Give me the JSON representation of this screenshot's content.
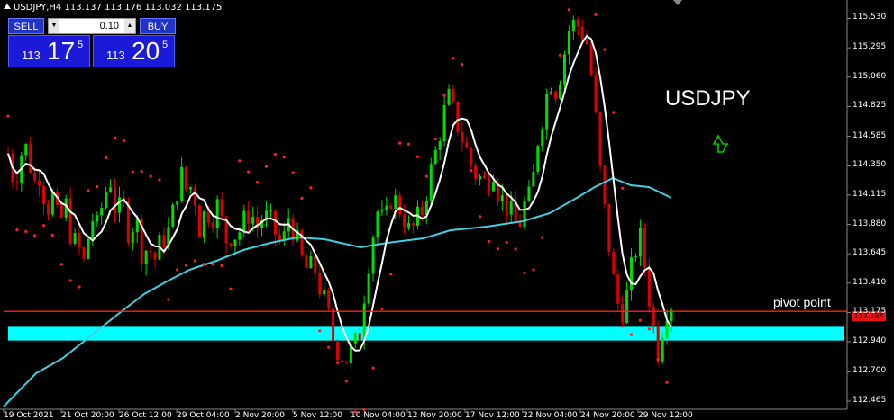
{
  "header": {
    "symbol_info": "USDJPY,H4  113.137 113.176 113.032 113.175"
  },
  "trade_panel": {
    "sell_label": "SELL",
    "buy_label": "BUY",
    "lot_value": "0.10",
    "sell_price": {
      "prefix": "113",
      "big": "17",
      "sup": "5"
    },
    "buy_price": {
      "prefix": "113",
      "big": "20",
      "sup": "5"
    }
  },
  "annotations": {
    "symbol_title": "USDJPY",
    "pivot_label": "pivot point",
    "arrow_icon": "up-arrow-icon",
    "current_price_tag": "113.184"
  },
  "colors": {
    "bull": "#00dd00",
    "bear": "#dd0000",
    "moving_avg_slow": "#40d0e0",
    "moving_avg_fast": "#ffffff",
    "parabolic_sar": "#ff2020",
    "pivot_line": "#ff2020",
    "zone": "#00ffff",
    "arrow": "#00cc00"
  },
  "chart_data": {
    "type": "candlestick",
    "symbol": "USDJPY",
    "timeframe": "H4",
    "ylim": [
      112.465,
      115.62
    ],
    "y_ticks": [
      "115.530",
      "115.295",
      "115.060",
      "114.825",
      "114.585",
      "114.350",
      "114.115",
      "113.880",
      "113.645",
      "113.410",
      "113.175",
      "112.940",
      "112.700",
      "112.465"
    ],
    "x_ticks": [
      "19 Oct 2021",
      "21 Oct 20:00",
      "26 Oct 12:00",
      "29 Oct 04:00",
      "2 Nov 20:00",
      "5 Nov 12:00",
      "10 Nov 04:00",
      "12 Nov 20:00",
      "17 Nov 12:00",
      "22 Nov 04:00",
      "24 Nov 20:00",
      "29 Nov 12:00"
    ],
    "pivot_point": 113.184,
    "zone": [
      112.95,
      113.06
    ],
    "close_path": [
      114.45,
      114.2,
      114.45,
      114.5,
      114.2,
      114.3,
      114.0,
      114.1,
      113.85,
      114.05,
      113.75,
      113.7,
      113.55,
      113.95,
      113.85,
      114.1,
      114.25,
      113.95,
      114.05,
      113.8,
      113.95,
      113.65,
      113.7,
      113.6,
      113.75,
      113.8,
      114.0,
      114.3,
      114.15,
      114.2,
      113.85,
      114.0,
      113.95,
      114.05,
      113.75,
      113.8,
      113.8,
      113.9,
      114.0,
      113.85,
      113.95,
      113.9,
      113.8,
      113.7,
      113.95,
      113.8,
      113.6,
      113.5,
      113.55,
      113.35,
      113.2,
      112.95,
      112.85,
      112.8,
      112.9,
      112.95,
      113.4,
      113.75,
      114.0,
      113.85,
      114.1,
      114.05,
      113.95,
      113.8,
      113.9,
      114.0,
      114.25,
      114.45,
      114.7,
      114.9,
      114.75,
      114.6,
      114.45,
      114.3,
      114.25,
      114.2,
      114.35,
      114.1,
      114.05,
      113.95,
      113.85,
      114.05,
      114.1,
      114.55,
      114.8,
      115.05,
      114.95,
      115.2,
      115.45,
      115.5,
      115.42,
      115.3,
      114.8,
      114.2,
      113.8,
      113.4,
      113.15,
      113.3,
      113.6,
      113.8,
      113.5,
      113.1,
      112.85,
      113.2,
      113.25
    ]
  }
}
